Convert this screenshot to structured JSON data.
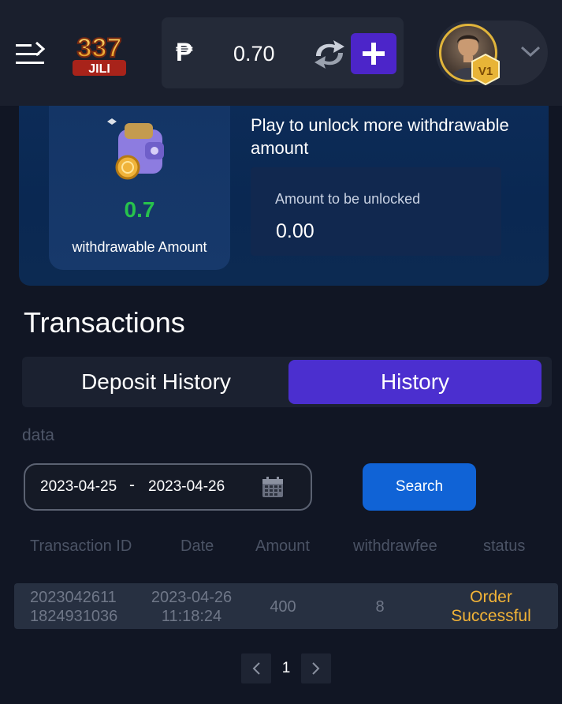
{
  "header": {
    "logo_text_top": "337",
    "logo_text_bottom": "JILI",
    "currency_symbol": "₱",
    "balance": "0.70",
    "vip_level": "V1"
  },
  "wallet": {
    "withdrawable_value": "0.7",
    "withdrawable_label": "withdrawable Amount",
    "unlock_title": "Play to unlock more withdrawable amount",
    "unlock_label": "Amount to be unlocked",
    "unlock_value": "0.00"
  },
  "transactions": {
    "title": "Transactions",
    "tabs": [
      {
        "label": "Deposit History",
        "active": false
      },
      {
        "label": "History",
        "active": true
      }
    ],
    "filter_label": "data",
    "date_start": "2023-04-25",
    "date_separator": "-",
    "date_end": "2023-04-26",
    "search_label": "Search",
    "columns": [
      "Transaction ID",
      "Date",
      "Amount",
      "withdrawfee",
      "status"
    ],
    "rows": [
      {
        "id_line1": "2023042611",
        "id_line2": "1824931036",
        "date_line1": "2023-04-26",
        "date_line2": "11:18:24",
        "amount": "400",
        "fee": "8",
        "status_line1": "Order",
        "status_line2": "Successful"
      }
    ],
    "current_page": "1"
  },
  "colors": {
    "accent_purple": "#4b2fcf",
    "search_blue": "#1063d6",
    "green": "#27c24c",
    "status_gold": "#f2b337"
  }
}
